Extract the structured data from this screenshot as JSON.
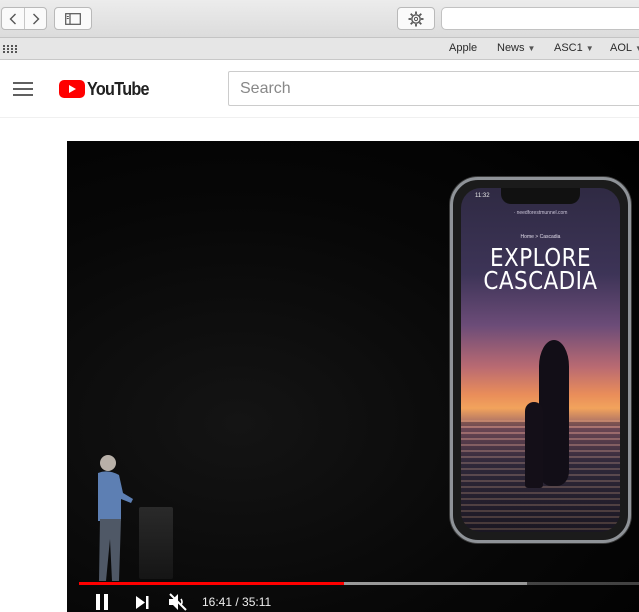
{
  "browser": {
    "favorites": [
      {
        "label": "Apple",
        "has_menu": false
      },
      {
        "label": "News",
        "has_menu": true
      },
      {
        "label": "ASC1",
        "has_menu": true
      },
      {
        "label": "AOL",
        "has_menu": true
      }
    ],
    "icons": [
      "back-arrow-icon",
      "forward-arrow-icon",
      "sidebar-icon",
      "gear-icon",
      "apps-grid-icon"
    ]
  },
  "youtube": {
    "wordmark": "YouTube",
    "search_placeholder": "Search",
    "brand_color": "#ff0000"
  },
  "video": {
    "phone_screen": {
      "status_time": "11:32",
      "url": "· needforestmunnel.com",
      "breadcrumb": "Home > Cascadia",
      "title_line1": "EXPLORE",
      "title_line2": "CASCADIA"
    },
    "player": {
      "current_time": "16:41",
      "duration": "35:11",
      "time_display": "16:41 / 35:11",
      "played_fraction": 0.474,
      "buffered_fraction": 0.8,
      "state": "playing",
      "muted": true,
      "progress_color": "#ff0000"
    }
  }
}
